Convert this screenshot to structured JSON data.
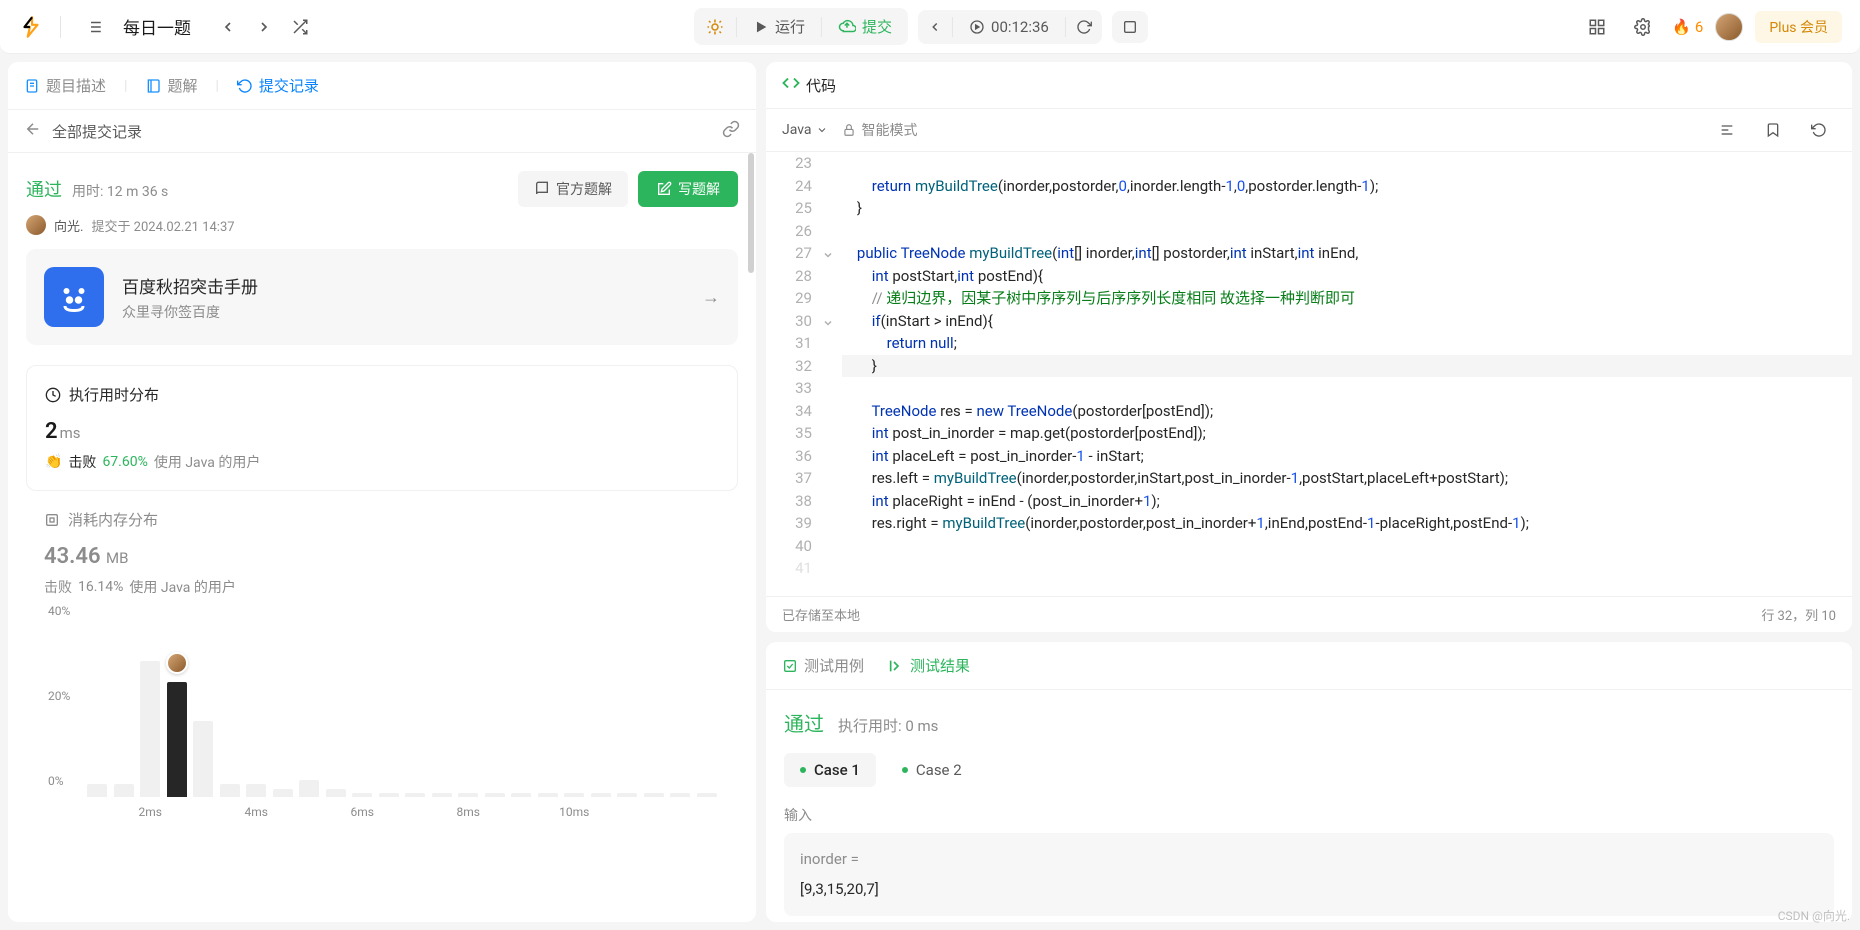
{
  "topbar": {
    "daily_title": "每日一题",
    "run": "运行",
    "submit": "提交",
    "timer": "00:12:36",
    "fire_count": "6",
    "plus": "Plus 会员"
  },
  "left": {
    "tabs": {
      "desc": "题目描述",
      "solutions": "题解",
      "submissions": "提交记录"
    },
    "sub_header": "全部提交记录",
    "status": {
      "pass": "通过",
      "time_used": "用时: 12 m 36 s",
      "official": "官方题解",
      "write": "写题解",
      "user": "向光.",
      "submitted_at": "提交于 2024.02.21 14:37"
    },
    "promo": {
      "title": "百度秋招突击手册",
      "sub": "众里寻你签百度"
    },
    "runtime": {
      "title": "执行用时分布",
      "val": "2",
      "unit": "ms",
      "beat": "击败",
      "pct": "67.60%",
      "suffix": "使用 Java 的用户"
    },
    "memory": {
      "title": "消耗内存分布",
      "val": "43.46",
      "unit": "MB",
      "beat": "击败",
      "pct": "16.14%",
      "suffix": "使用 Java 的用户"
    }
  },
  "chart_data": {
    "type": "bar",
    "ylabel_pct": [
      "40%",
      "20%",
      "0%"
    ],
    "x_ticks": [
      "2ms",
      "4ms",
      "6ms",
      "8ms",
      "10ms"
    ],
    "bars": [
      3,
      3,
      32,
      27,
      18,
      3,
      3,
      2,
      4,
      2,
      1,
      1,
      1,
      1,
      1,
      1,
      1,
      1,
      1,
      1,
      1,
      1,
      1,
      1
    ],
    "me_index": 3
  },
  "code": {
    "tab": "代码",
    "lang": "Java",
    "mode": "智能模式",
    "saved": "已存储至本地",
    "cursor": "行 32，列 10",
    "start_line": 23,
    "lines": [
      "",
      "        return myBuildTree(inorder,postorder,0,inorder.length-1,0,postorder.length-1);",
      "    }",
      "",
      "    public TreeNode myBuildTree(int[] inorder,int[] postorder,int inStart,int inEnd,",
      "        int postStart,int postEnd){",
      "        // 递归边界，因某子树中序序列与后序序列长度相同 故选择一种判断即可",
      "        if(inStart > inEnd){",
      "            return null;",
      "        }",
      "",
      "        TreeNode res = new TreeNode(postorder[postEnd]);",
      "        int post_in_inorder = map.get(postorder[postEnd]);",
      "        int placeLeft = post_in_inorder-1 - inStart;",
      "        res.left = myBuildTree(inorder,postorder,inStart,post_in_inorder-1,postStart,placeLeft+postStart);",
      "        int placeRight = inEnd - (post_in_inorder+1);",
      "        res.right = myBuildTree(inorder,postorder,post_in_inorder+1,inEnd,postEnd-1-placeRight,postEnd-1);",
      ""
    ]
  },
  "test": {
    "cases_tab": "测试用例",
    "results_tab": "测试结果",
    "pass": "通过",
    "time": "执行用时: 0 ms",
    "case1": "Case 1",
    "case2": "Case 2",
    "input_label": "输入",
    "input_var": "inorder =",
    "input_val": "[9,3,15,20,7]"
  },
  "watermark": "CSDN @向光."
}
